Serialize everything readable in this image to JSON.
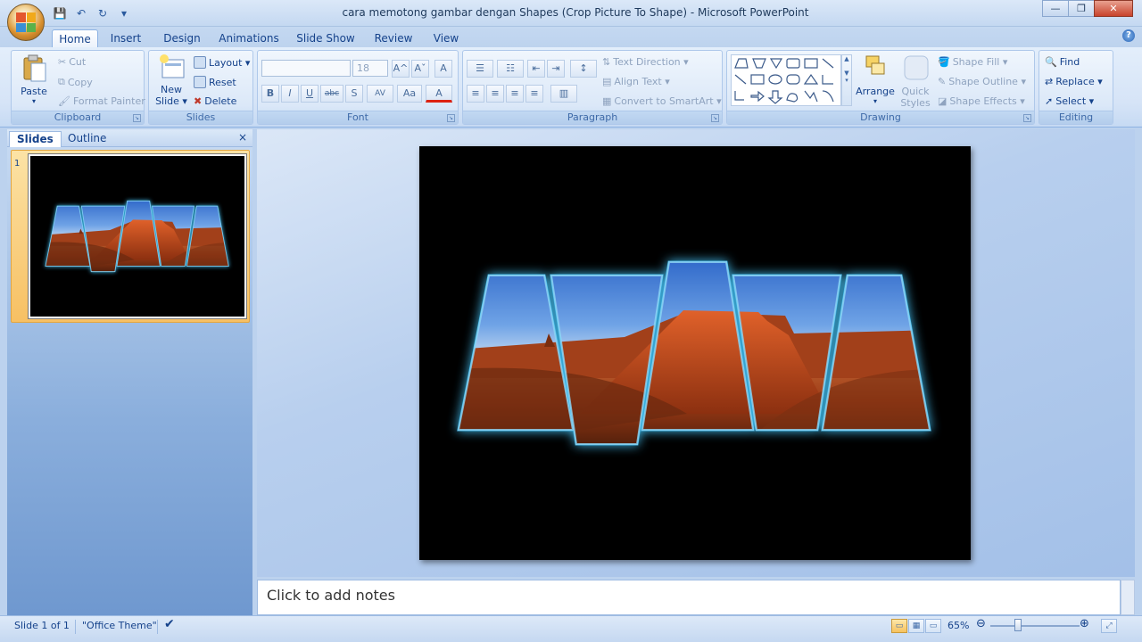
{
  "window": {
    "title": "cara memotong gambar dengan Shapes (Crop Picture To Shape)  - Microsoft PowerPoint",
    "controls": [
      "—",
      "❐",
      "✕"
    ]
  },
  "qat": {
    "save": "💾",
    "undo": "↶",
    "repeat": "↻",
    "customize": "▾"
  },
  "tabs": [
    "Home",
    "Insert",
    "Design",
    "Animations",
    "Slide Show",
    "Review",
    "View"
  ],
  "active_tab": "Home",
  "ribbon": {
    "clipboard": {
      "label": "Clipboard",
      "paste": "Paste",
      "cut": "Cut",
      "copy": "Copy",
      "format_painter": "Format Painter"
    },
    "slides": {
      "label": "Slides",
      "new_slide_1": "New",
      "new_slide_2": "Slide ▾",
      "layout": "Layout ▾",
      "reset": "Reset",
      "delete": "Delete"
    },
    "font": {
      "label": "Font",
      "font_name": "",
      "font_size": "18",
      "bold": "B",
      "italic": "I",
      "underline": "U",
      "strike": "abc",
      "shadow": "S",
      "spacing": "AV",
      "case": "Aa",
      "color": "A",
      "grow": "A^",
      "shrink": "Aˇ",
      "clear": "A"
    },
    "paragraph": {
      "label": "Paragraph",
      "text_direction": "Text Direction ▾",
      "align_text": "Align Text ▾",
      "convert_smartart": "Convert to SmartArt ▾"
    },
    "drawing": {
      "label": "Drawing",
      "arrange": "Arrange",
      "quick_styles_1": "Quick",
      "quick_styles_2": "Styles ▾",
      "shape_fill": "Shape Fill ▾",
      "shape_outline": "Shape Outline ▾",
      "shape_effects": "Shape Effects ▾"
    },
    "editing": {
      "label": "Editing",
      "find": "Find",
      "replace": "Replace ▾",
      "select": "Select ▾"
    }
  },
  "left_panel": {
    "tab_slides": "Slides",
    "tab_outline": "Outline",
    "close": "×",
    "slide_number": "1"
  },
  "notes": {
    "placeholder": "Click to add notes"
  },
  "status": {
    "slide_info": "Slide 1 of 1",
    "theme": "\"Office Theme\"",
    "zoom": "65%"
  },
  "colors": {
    "accent": "#15428b",
    "glow": "#3fb6e6",
    "sky_top": "#3a78d8",
    "desert": "#b2431a"
  }
}
